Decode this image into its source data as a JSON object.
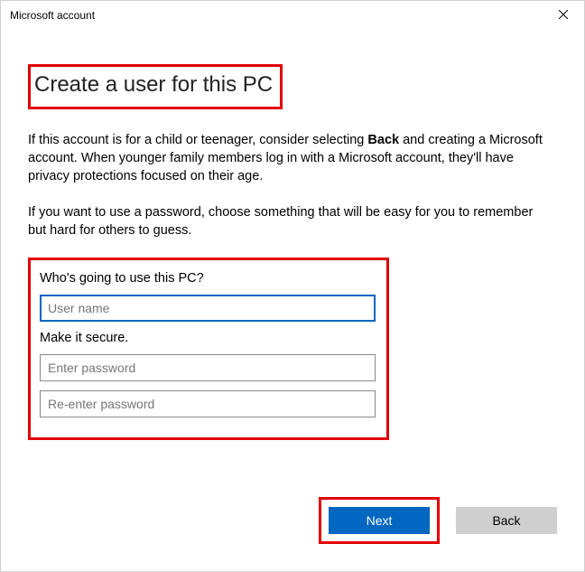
{
  "window": {
    "title": "Microsoft account"
  },
  "heading": "Create a user for this PC",
  "para1_pre": "If this account is for a child or teenager, consider selecting ",
  "para1_bold": "Back",
  "para1_post": " and creating a Microsoft account. When younger family members log in with a Microsoft account, they'll have privacy protections focused on their age.",
  "para2": "If you want to use a password, choose something that will be easy for you to remember but hard for others to guess.",
  "form": {
    "who_label": "Who's going to use this PC?",
    "username_placeholder": "User name",
    "username_value": "",
    "secure_label": "Make it secure.",
    "password_placeholder": "Enter password",
    "password2_placeholder": "Re-enter password"
  },
  "buttons": {
    "next": "Next",
    "back": "Back"
  }
}
